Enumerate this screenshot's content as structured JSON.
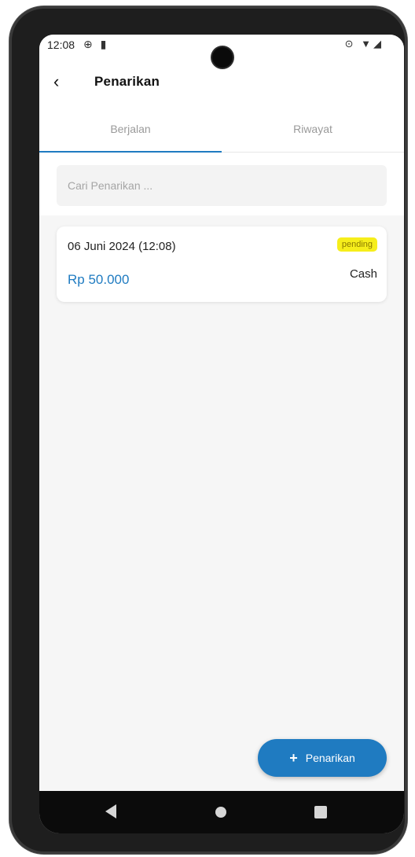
{
  "status_bar": {
    "time": "12:08",
    "left_icons": "⊕ ▮",
    "right_icons": "⊙ ▼◢"
  },
  "app_bar": {
    "back_glyph": "‹",
    "title": "Penarikan"
  },
  "tabs": [
    {
      "label": "Berjalan",
      "active": true
    },
    {
      "label": "Riwayat",
      "active": false
    }
  ],
  "search": {
    "placeholder": "Cari Penarikan ..."
  },
  "withdrawals": [
    {
      "date": "06 Juni 2024 (12:08)",
      "status": "pending",
      "amount": "Rp 50.000",
      "method": "Cash"
    }
  ],
  "fab": {
    "icon": "+",
    "label": "Penarikan"
  },
  "colors": {
    "accent": "#1f7bc1",
    "badge_bg": "#f6ee1b",
    "background": "#f6f6f6"
  },
  "icons": {
    "back": "arrow-back-icon",
    "add": "plus-icon",
    "nav_back": "triangle-back-icon",
    "nav_home": "circle-home-icon",
    "nav_recent": "square-recent-icon"
  }
}
